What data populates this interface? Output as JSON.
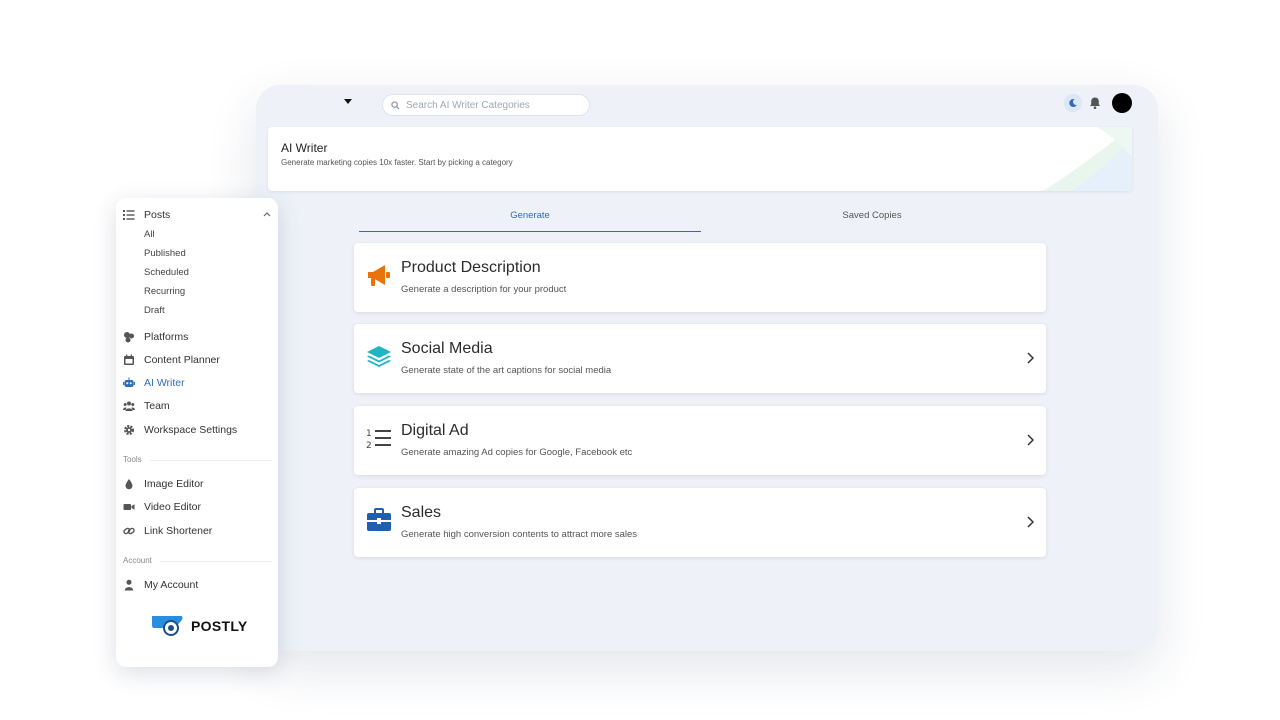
{
  "search": {
    "placeholder": "Search AI Writer Categories"
  },
  "header": {
    "title": "AI Writer",
    "subtitle": "Generate marketing copies 10x faster. Start by picking a category"
  },
  "tabs": [
    {
      "label": "Generate",
      "active": true
    },
    {
      "label": "Saved Copies",
      "active": false
    }
  ],
  "categories": [
    {
      "title": "Product Description",
      "description": "Generate a description for your product",
      "icon": "megaphone-icon",
      "color": "#e8730c"
    },
    {
      "title": "Social Media",
      "description": "Generate state of the art captions for social media",
      "icon": "layers-icon",
      "color": "#1fb5c4"
    },
    {
      "title": "Digital Ad",
      "description": "Generate amazing Ad copies for Google, Facebook etc",
      "icon": "numbered-list-icon",
      "color": "#444444"
    },
    {
      "title": "Sales",
      "description": "Generate high conversion contents to attract more sales",
      "icon": "briefcase-icon",
      "color": "#1f5fae"
    }
  ],
  "sidebar": {
    "posts": {
      "label": "Posts",
      "items": [
        "All",
        "Published",
        "Scheduled",
        "Recurring",
        "Draft"
      ]
    },
    "nav": [
      {
        "label": "Platforms",
        "icon": "platforms-icon"
      },
      {
        "label": "Content Planner",
        "icon": "calendar-icon"
      },
      {
        "label": "AI Writer",
        "icon": "robot-icon",
        "active": true
      },
      {
        "label": "Team",
        "icon": "team-icon"
      },
      {
        "label": "Workspace Settings",
        "icon": "gear-icon"
      }
    ],
    "tools_label": "Tools",
    "tools": [
      {
        "label": "Image Editor",
        "icon": "drop-icon"
      },
      {
        "label": "Video Editor",
        "icon": "video-icon"
      },
      {
        "label": "Link Shortener",
        "icon": "link-icon"
      }
    ],
    "account_label": "Account",
    "account": [
      {
        "label": "My Account",
        "icon": "user-icon"
      }
    ],
    "brand": "POSTLY"
  },
  "colors": {
    "accent": "#2f6eb5",
    "background": "#eef2f8"
  }
}
